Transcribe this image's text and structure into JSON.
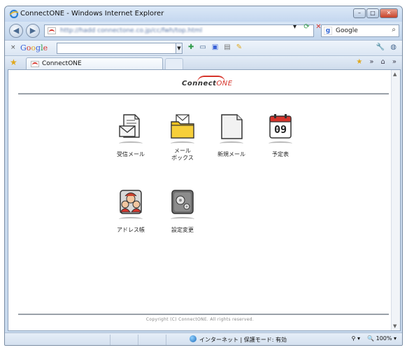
{
  "window": {
    "title": "ConnectONE - Windows Internet Explorer",
    "controls": {
      "minimize": "–",
      "maximize": "□",
      "close": "✕"
    }
  },
  "address_bar": {
    "url": "http://hadd connectone.co.jp/cc/fwh/top.html",
    "refresh_icon": "⟳",
    "stop_icon": "✕",
    "dropdown_icon": "▾"
  },
  "search": {
    "engine": "Google",
    "placeholder": "Google",
    "button_icon": "⌕"
  },
  "google_toolbar": {
    "close": "×",
    "logo": [
      "G",
      "o",
      "o",
      "g",
      "l",
      "e"
    ],
    "input_value": ""
  },
  "tabs": [
    {
      "label": "ConnectONE",
      "active": true
    }
  ],
  "page": {
    "brand": {
      "text": "Connect",
      "accent": "ONE"
    },
    "apps": [
      {
        "id": "inbox",
        "label": "受信メール",
        "icon": "inbox-mail-icon"
      },
      {
        "id": "mailbox",
        "label": "メール\nボックス",
        "icon": "mailbox-folder-icon"
      },
      {
        "id": "new_mail",
        "label": "新規メール",
        "icon": "new-mail-icon"
      },
      {
        "id": "schedule",
        "label": "予定表",
        "icon": "calendar-icon",
        "calendar_day": "09"
      },
      {
        "id": "address_book",
        "label": "アドレス帳",
        "icon": "address-book-icon"
      },
      {
        "id": "settings",
        "label": "設定変更",
        "icon": "settings-gear-icon"
      }
    ],
    "copyright": "Copyright (C) ConnectONE. All rights reserved."
  },
  "status_bar": {
    "zone_text": "インターネット | 保護モード: 有効",
    "zoom": "100%",
    "zoom_icon": "🔍"
  },
  "colors": {
    "accent_red": "#d6342b",
    "folder_yellow": "#f4c21f",
    "frame_blue": "#c9daee"
  }
}
